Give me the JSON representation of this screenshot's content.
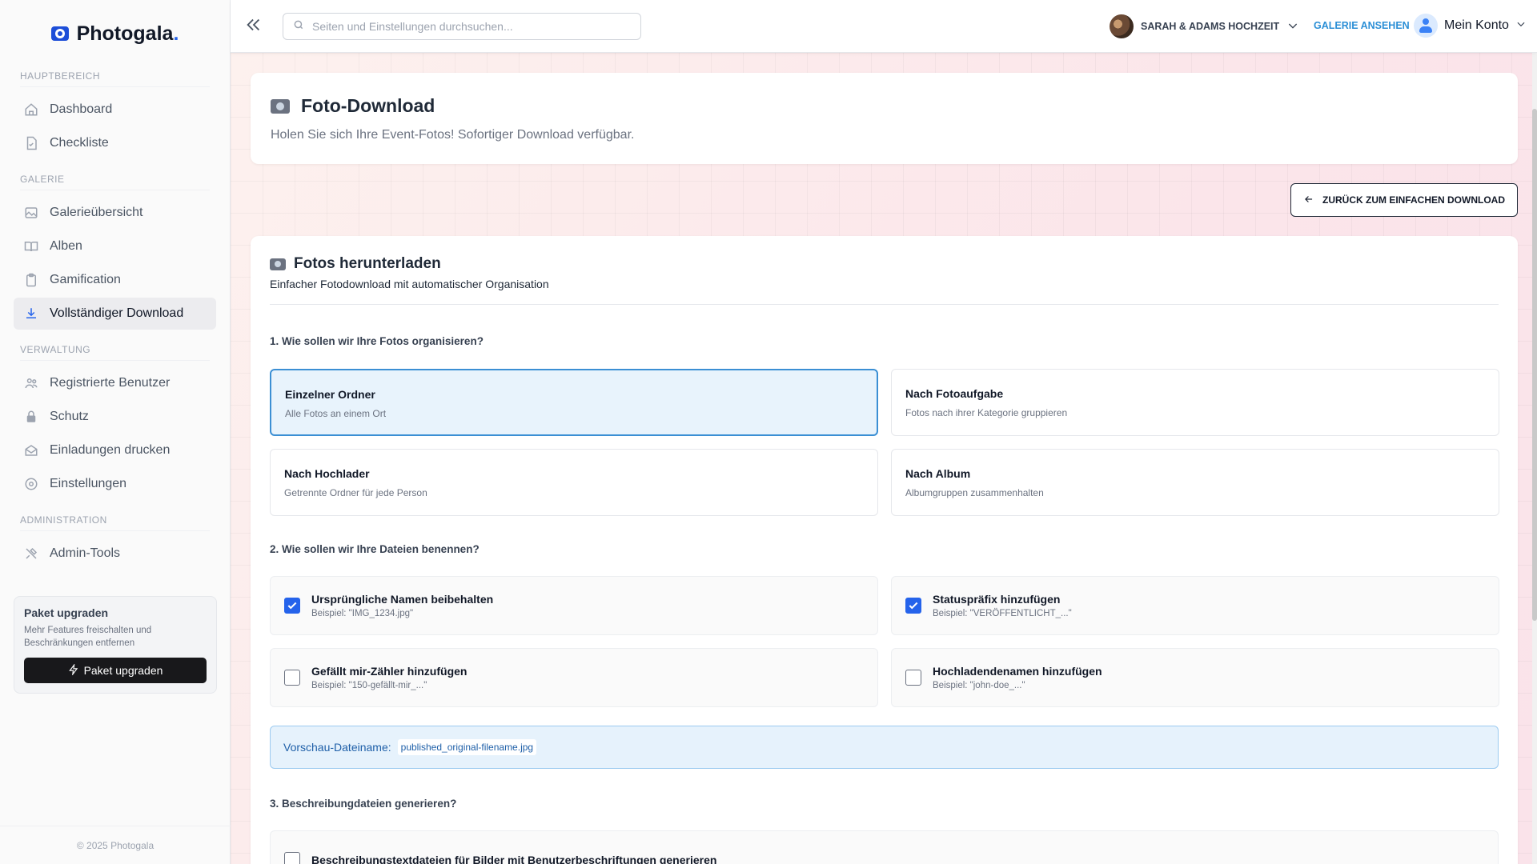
{
  "brand": {
    "name": "Photogala",
    "dot": "."
  },
  "sidebar": {
    "sections": {
      "main": "HAUPTBEREICH",
      "gallery": "GALERIE",
      "admin": "VERWALTUNG",
      "administration": "ADMINISTRATION"
    },
    "items": [
      {
        "label": "Dashboard",
        "icon": "home-icon"
      },
      {
        "label": "Checkliste",
        "icon": "file-check-icon"
      },
      {
        "label": "Galerieübersicht",
        "icon": "image-icon"
      },
      {
        "label": "Alben",
        "icon": "book-open-icon"
      },
      {
        "label": "Gamification",
        "icon": "clipboard-icon"
      },
      {
        "label": "Vollständiger Download",
        "icon": "download-icon",
        "active": true
      },
      {
        "label": "Registrierte Benutzer",
        "icon": "users-icon"
      },
      {
        "label": "Schutz",
        "icon": "lock-icon"
      },
      {
        "label": "Einladungen drucken",
        "icon": "mail-open-icon"
      },
      {
        "label": "Einstellungen",
        "icon": "settings-icon"
      },
      {
        "label": "Admin-Tools",
        "icon": "tools-icon"
      }
    ],
    "upgrade": {
      "title": "Paket upgraden",
      "desc": "Mehr Features freischalten und Beschränkungen entfernen",
      "button": "Paket upgraden"
    },
    "footer": "© 2025 Photogala"
  },
  "header": {
    "search_placeholder": "Seiten und Einstellungen durchsuchen...",
    "event_name": "SARAH & ADAMS HOCHZEIT",
    "gallery_link": "GALERIE ANSEHEN",
    "account_label": "Mein Konto"
  },
  "page": {
    "title": "Foto-Download",
    "subtitle": "Holen Sie sich Ihre Event-Fotos! Sofortiger Download verfügbar.",
    "back_button": "ZURÜCK ZUM EINFACHEN DOWNLOAD"
  },
  "download": {
    "title": "Fotos herunterladen",
    "subtitle": "Einfacher Fotodownload mit automatischer Organisation",
    "q1": "1. Wie sollen wir Ihre Fotos organisieren?",
    "organize_options": [
      {
        "title": "Einzelner Ordner",
        "desc": "Alle Fotos an einem Ort",
        "selected": true
      },
      {
        "title": "Nach Fotoaufgabe",
        "desc": "Fotos nach ihrer Kategorie gruppieren",
        "selected": false
      },
      {
        "title": "Nach Hochlader",
        "desc": "Getrennte Ordner für jede Person",
        "selected": false
      },
      {
        "title": "Nach Album",
        "desc": "Albumgruppen zusammenhalten",
        "selected": false
      }
    ],
    "q2": "2. Wie sollen wir Ihre Dateien benennen?",
    "naming_options": [
      {
        "title": "Ursprüngliche Namen beibehalten",
        "example": "Beispiel: \"IMG_1234.jpg\"",
        "checked": true
      },
      {
        "title": "Statuspräfix hinzufügen",
        "example": "Beispiel: \"VERÖFFENTLICHT_...\"",
        "checked": true
      },
      {
        "title": "Gefällt mir-Zähler hinzufügen",
        "example": "Beispiel: \"150-gefällt-mir_...\"",
        "checked": false
      },
      {
        "title": "Hochladendenamen hinzufügen",
        "example": "Beispiel: \"john-doe_...\"",
        "checked": false
      }
    ],
    "preview_label": "Vorschau-Dateiname:",
    "preview_value": "published_original-filename.jpg",
    "q3": "3. Beschreibungdateien generieren?",
    "description_option": {
      "title": "Beschreibungstextdateien für Bilder mit Benutzerbeschriftungen generieren",
      "checked": false
    }
  },
  "colors": {
    "accent": "#2563eb",
    "link": "#2b8fd6",
    "selected_bg": "#e8f3fc"
  }
}
